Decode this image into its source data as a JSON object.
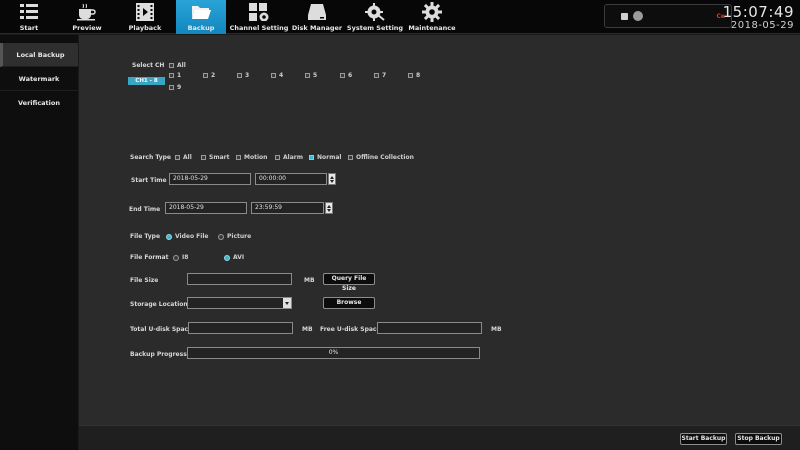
{
  "nav": {
    "items": [
      {
        "label": "Start",
        "icon": "start-grid-icon"
      },
      {
        "label": "Preview",
        "icon": "preview-coffee-icon"
      },
      {
        "label": "Playback",
        "icon": "playback-film-icon"
      },
      {
        "label": "Backup",
        "icon": "backup-folder-icon"
      },
      {
        "label": "Channel Setting",
        "icon": "channel-setting-icon"
      },
      {
        "label": "Disk Manager",
        "icon": "disk-manager-icon"
      },
      {
        "label": "System Setting",
        "icon": "system-setting-icon"
      },
      {
        "label": "Maintenance",
        "icon": "maintenance-gear-icon"
      }
    ],
    "active": "Backup"
  },
  "clock": {
    "time": "15:07:49",
    "date": "2018-05-29"
  },
  "status": {
    "badge": "Ce"
  },
  "sidebar": {
    "items": [
      {
        "label": "Local Backup"
      },
      {
        "label": "Watermark Verification"
      }
    ]
  },
  "form": {
    "select_ch": {
      "label": "Select CH",
      "all": "All",
      "range_button": "CH1 - 8",
      "channels": [
        "1",
        "2",
        "3",
        "4",
        "5",
        "6",
        "7",
        "8",
        "9"
      ]
    },
    "search_type": {
      "label": "Search Type",
      "options": [
        "All",
        "Smart",
        "Motion",
        "Alarm",
        "Normal",
        "Offline Collection"
      ],
      "checked": "Normal"
    },
    "start_time": {
      "label": "Start Time",
      "date": "2018-05-29",
      "time": "00:00:00"
    },
    "end_time": {
      "label": "End Time",
      "date": "2018-05-29",
      "time": "23:59:59"
    },
    "file_type": {
      "label": "File Type",
      "options": [
        "Video File",
        "Picture"
      ],
      "selected": "Video File"
    },
    "file_format": {
      "label": "File Format",
      "options": [
        "I8",
        "AVI"
      ],
      "selected": "AVI"
    },
    "file_size": {
      "label": "File Size",
      "value": "",
      "unit": "MB",
      "query_button": "Query File Size"
    },
    "storage_location": {
      "label": "Storage Location",
      "value": "",
      "browse_button": "Browse"
    },
    "total_udisk": {
      "label": "Total U-disk Space",
      "value": "",
      "unit": "MB"
    },
    "free_udisk": {
      "label": "Free U-disk Space",
      "value": "",
      "unit": "MB"
    },
    "backup_progress": {
      "label": "Backup Progress",
      "text": "0%",
      "fraction": 0
    }
  },
  "footer": {
    "start_backup": "Start Backup",
    "stop_backup": "Stop Backup"
  },
  "colors": {
    "accent": "#2aa4d8",
    "panel": "#2b2b2b",
    "sidebar": "#0e0e0e",
    "topbar": "#070707"
  }
}
